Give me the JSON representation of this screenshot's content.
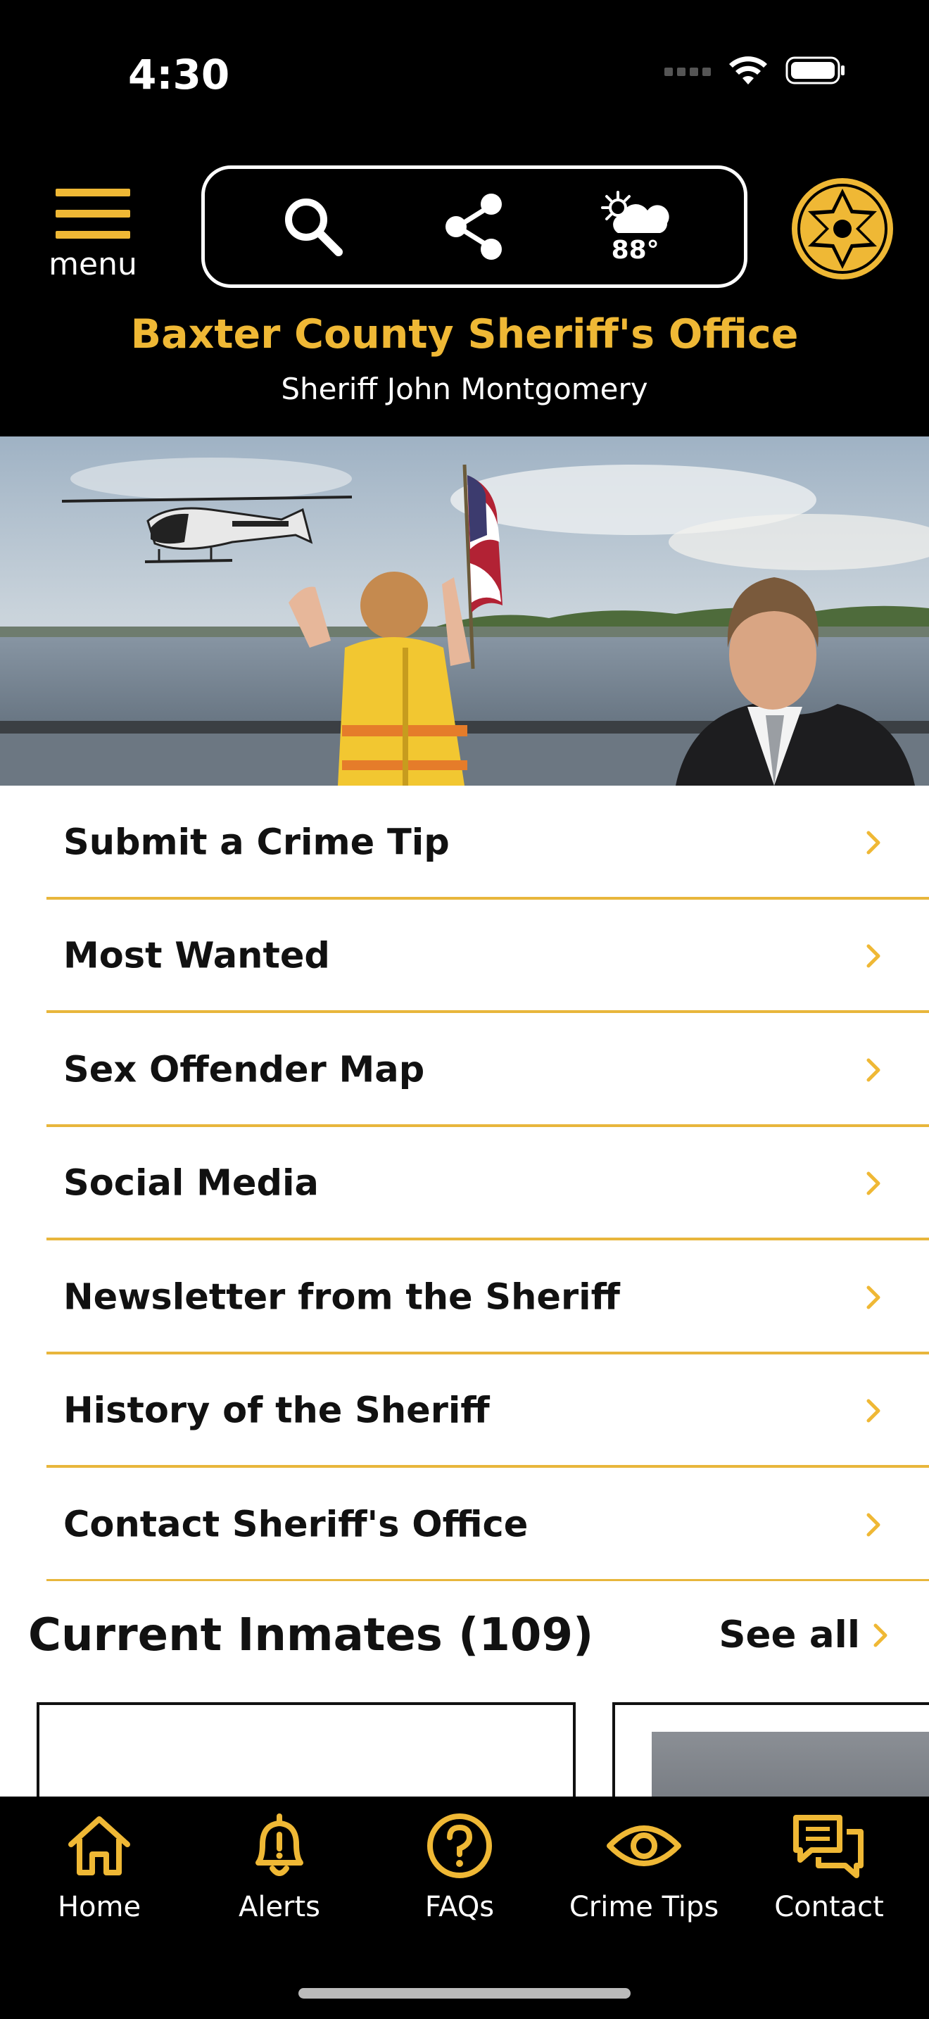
{
  "status_bar": {
    "time": "4:30"
  },
  "header": {
    "menu_label": "menu",
    "temperature": "88°",
    "office_name": "Baxter County Sheriff's Office",
    "sheriff_name": "Sheriff John Montgomery",
    "accent_color": "#efb835",
    "icons": [
      "menu-icon",
      "search-icon",
      "share-icon",
      "weather-partly-cloudy-icon",
      "sheriff-badge-icon"
    ]
  },
  "menu": {
    "items": [
      {
        "label": "Submit a Crime Tip"
      },
      {
        "label": "Most Wanted"
      },
      {
        "label": "Sex Offender Map"
      },
      {
        "label": "Social Media"
      },
      {
        "label": "Newsletter from the Sheriff"
      },
      {
        "label": "History of the Sheriff"
      },
      {
        "label": "Contact Sheriff's Office"
      }
    ]
  },
  "inmates": {
    "title": "Current Inmates (109)",
    "see_all_label": "See all"
  },
  "tabbar": {
    "tabs": [
      {
        "label": "Home",
        "icon": "home-icon"
      },
      {
        "label": "Alerts",
        "icon": "bell-alert-icon"
      },
      {
        "label": "FAQs",
        "icon": "question-icon"
      },
      {
        "label": "Crime Tips",
        "icon": "eye-icon"
      },
      {
        "label": "Contact",
        "icon": "chat-icon"
      }
    ]
  }
}
